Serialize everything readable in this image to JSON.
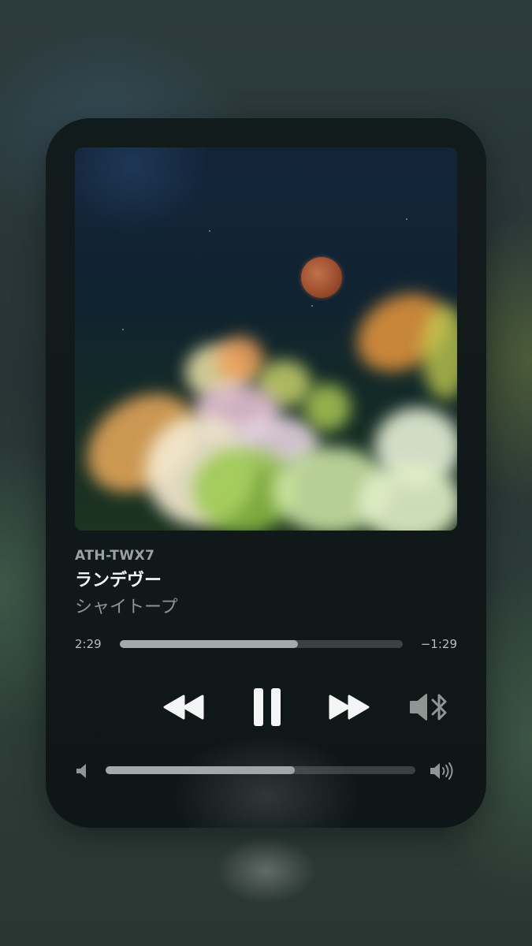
{
  "now_playing": {
    "device_name": "ATH-TWX7",
    "title": "ランデヴー",
    "artist": "シャイトープ",
    "artwork": "album-artwork-moon-flowers"
  },
  "progress": {
    "elapsed": "2:29",
    "remaining": "−1:29",
    "fraction": 0.63
  },
  "controls": {
    "rewind_icon": "rewind-icon",
    "pause_icon": "pause-icon",
    "forward_icon": "fast-forward-icon",
    "output_icon": "bluetooth-speaker-icon"
  },
  "volume": {
    "min_icon": "speaker-min-icon",
    "max_icon": "speaker-max-icon",
    "fraction": 0.61
  },
  "colors": {
    "accent_fill": "#a3a9ac",
    "track": "#394142",
    "card_bg": "#121b1c"
  }
}
